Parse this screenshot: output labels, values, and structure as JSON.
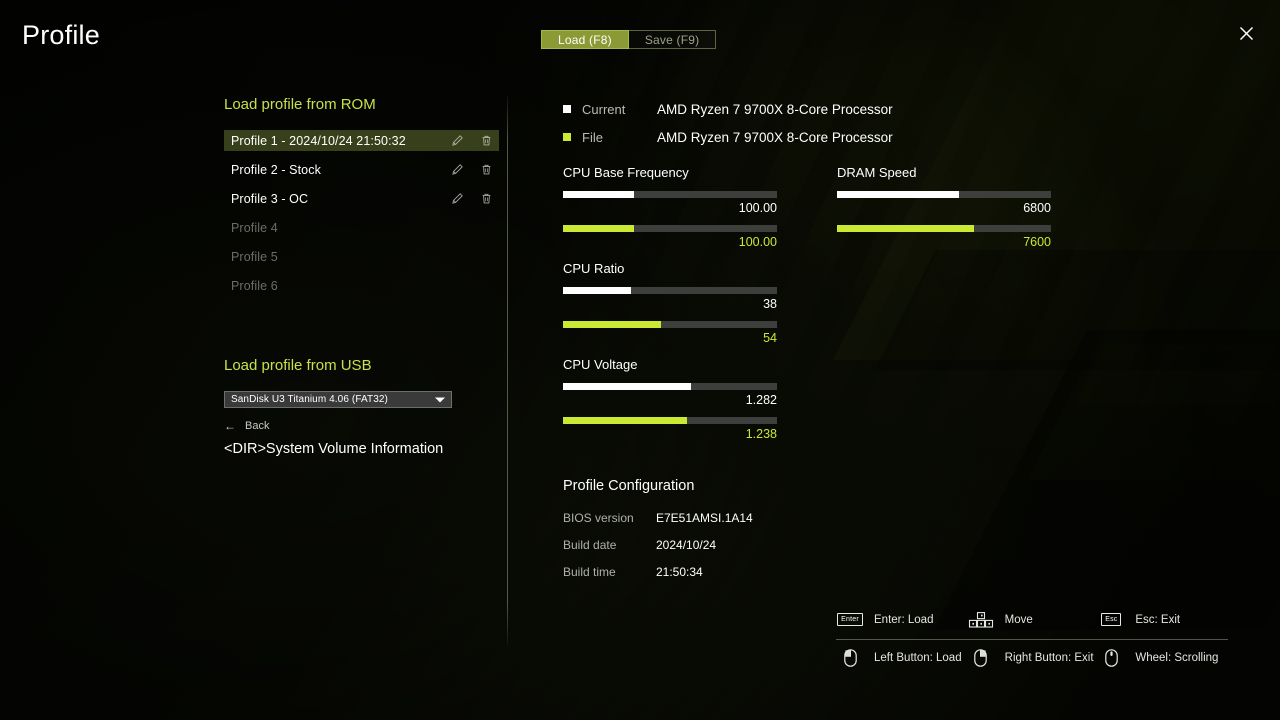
{
  "header": {
    "title": "Profile",
    "tabs": [
      {
        "label": "Load (F8)",
        "active": true
      },
      {
        "label": "Save (F9)",
        "active": false
      }
    ],
    "close_icon": "close-icon"
  },
  "left": {
    "rom_section_title": "Load profile from ROM",
    "profiles": [
      {
        "label": "Profile 1 - 2024/10/24 21:50:32",
        "selected": true,
        "enabled": true
      },
      {
        "label": "Profile 2 - Stock",
        "selected": false,
        "enabled": true
      },
      {
        "label": "Profile 3 - OC",
        "selected": false,
        "enabled": true
      },
      {
        "label": "Profile 4",
        "selected": false,
        "enabled": false
      },
      {
        "label": "Profile 5",
        "selected": false,
        "enabled": false
      },
      {
        "label": "Profile 6",
        "selected": false,
        "enabled": false
      }
    ],
    "row_icons": {
      "edit": "pencil-icon",
      "delete": "trash-icon"
    },
    "usb_section_title": "Load profile from USB",
    "usb_device_selected": "SanDisk U3 Titanium 4.06 (FAT32)",
    "back_label": "Back",
    "back_arrow": "←",
    "file_entry": "<DIR>System Volume Information"
  },
  "right": {
    "legend": [
      {
        "marker": "current",
        "key": "Current",
        "value": "AMD Ryzen 7 9700X 8-Core Processor"
      },
      {
        "marker": "file",
        "key": "File",
        "value": "AMD Ryzen 7 9700X 8-Core Processor"
      }
    ],
    "metrics": [
      {
        "title": "CPU Base Frequency",
        "current": {
          "value": "100.00",
          "percent": 33
        },
        "file": {
          "value": "100.00",
          "percent": 33
        }
      },
      {
        "title": "DRAM Speed",
        "current": {
          "value": "6800",
          "percent": 57
        },
        "file": {
          "value": "7600",
          "percent": 64
        }
      },
      {
        "title": "CPU Ratio",
        "current": {
          "value": "38",
          "percent": 32
        },
        "file": {
          "value": "54",
          "percent": 46
        }
      },
      {
        "title": "CPU Voltage",
        "current": {
          "value": "1.282",
          "percent": 60
        },
        "file": {
          "value": "1.238",
          "percent": 58
        }
      }
    ],
    "profile_configuration": {
      "title": "Profile Configuration",
      "rows": [
        {
          "key": "BIOS version",
          "value": "E7E51AMSI.1A14"
        },
        {
          "key": "Build date",
          "value": "2024/10/24"
        },
        {
          "key": "Build time",
          "value": "21:50:34"
        }
      ]
    }
  },
  "hints": {
    "row1": [
      {
        "glyph": "enter-key-icon",
        "cap": "Enter",
        "label": "Enter: Load"
      },
      {
        "glyph": "arrow-keys-icon",
        "cap": "",
        "label": "Move"
      },
      {
        "glyph": "esc-key-icon",
        "cap": "Esc",
        "label": "Esc: Exit"
      }
    ],
    "row2": [
      {
        "glyph": "mouse-left-icon",
        "label": "Left Button: Load"
      },
      {
        "glyph": "mouse-right-icon",
        "label": "Right Button: Exit"
      },
      {
        "glyph": "mouse-wheel-icon",
        "label": "Wheel: Scrolling"
      }
    ]
  },
  "colors": {
    "accent_green": "#cbe832",
    "section_heading": "#c9e04a",
    "tab_active_bg": "#8b9a34",
    "selected_row_bg": "#37401a",
    "bar_track": "#3d3f3c"
  }
}
